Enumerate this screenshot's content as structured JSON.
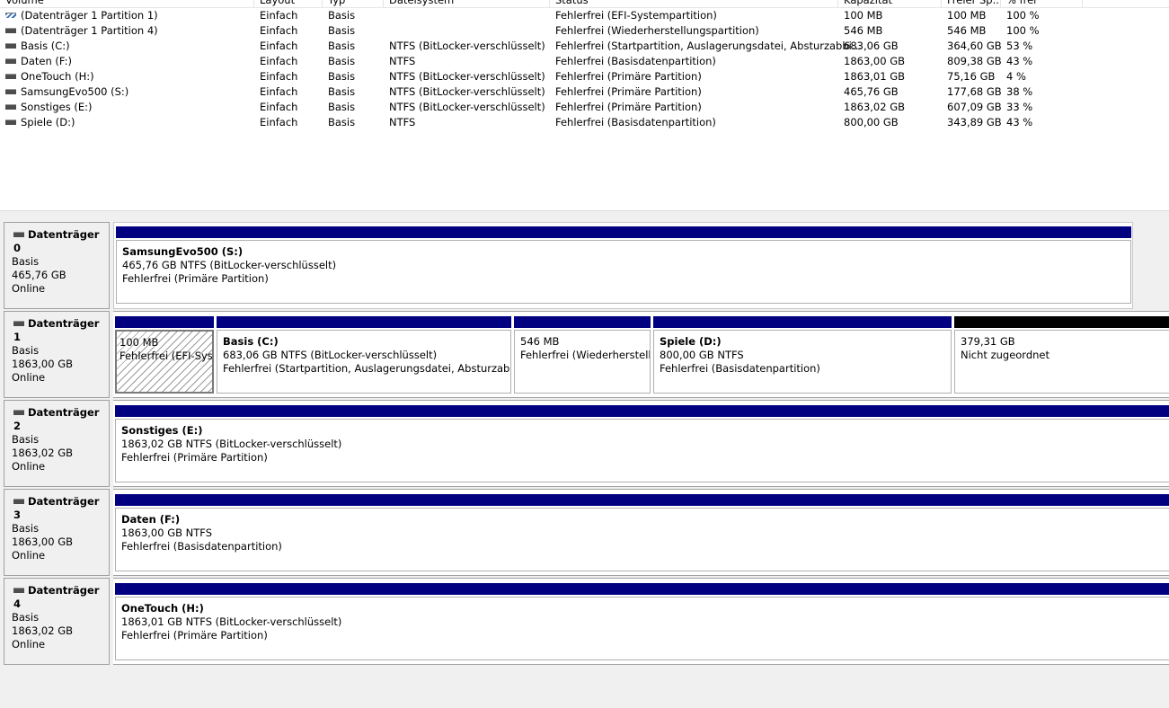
{
  "volume_table": {
    "columns": [
      "Volume",
      "Layout",
      "Typ",
      "Dateisystem",
      "Status",
      "Kapazität",
      "Freier Sp...",
      "% frei"
    ],
    "rows": [
      {
        "icon": "striped-volume-icon",
        "volume": "(Datenträger 1 Partition 1)",
        "layout": "Einfach",
        "typ": "Basis",
        "fs": "",
        "status": "Fehlerfrei (EFI-Systempartition)",
        "cap": "100 MB",
        "free": "100 MB",
        "pct": "100 %"
      },
      {
        "icon": "volume-icon",
        "volume": "(Datenträger 1 Partition 4)",
        "layout": "Einfach",
        "typ": "Basis",
        "fs": "",
        "status": "Fehlerfrei (Wiederherstellungspartition)",
        "cap": "546 MB",
        "free": "546 MB",
        "pct": "100 %"
      },
      {
        "icon": "volume-icon",
        "volume": "Basis (C:)",
        "layout": "Einfach",
        "typ": "Basis",
        "fs": "NTFS (BitLocker-verschlüsselt)",
        "status": "Fehlerfrei (Startpartition, Auslagerungsdatei, Absturzabbi...",
        "cap": "683,06 GB",
        "free": "364,60 GB",
        "pct": "53 %"
      },
      {
        "icon": "volume-icon",
        "volume": "Daten (F:)",
        "layout": "Einfach",
        "typ": "Basis",
        "fs": "NTFS",
        "status": "Fehlerfrei (Basisdatenpartition)",
        "cap": "1863,00 GB",
        "free": "809,38 GB",
        "pct": "43 %"
      },
      {
        "icon": "volume-icon",
        "volume": "OneTouch (H:)",
        "layout": "Einfach",
        "typ": "Basis",
        "fs": "NTFS (BitLocker-verschlüsselt)",
        "status": "Fehlerfrei (Primäre Partition)",
        "cap": "1863,01 GB",
        "free": "75,16 GB",
        "pct": "4 %"
      },
      {
        "icon": "volume-icon",
        "volume": "SamsungEvo500 (S:)",
        "layout": "Einfach",
        "typ": "Basis",
        "fs": "NTFS (BitLocker-verschlüsselt)",
        "status": "Fehlerfrei (Primäre Partition)",
        "cap": "465,76 GB",
        "free": "177,68 GB",
        "pct": "38 %"
      },
      {
        "icon": "volume-icon",
        "volume": "Sonstiges (E:)",
        "layout": "Einfach",
        "typ": "Basis",
        "fs": "NTFS (BitLocker-verschlüsselt)",
        "status": "Fehlerfrei (Primäre Partition)",
        "cap": "1863,02 GB",
        "free": "607,09 GB",
        "pct": "33 %"
      },
      {
        "icon": "volume-icon",
        "volume": "Spiele (D:)",
        "layout": "Einfach",
        "typ": "Basis",
        "fs": "NTFS",
        "status": "Fehlerfrei (Basisdatenpartition)",
        "cap": "800,00 GB",
        "free": "343,89 GB",
        "pct": "43 %"
      }
    ]
  },
  "disks": [
    {
      "title": "Datenträger 0",
      "type": "Basis",
      "size": "465,76 GB",
      "state": "Online",
      "partitions": [
        {
          "name": "SamsungEvo500  (S:)",
          "line1": "465,76 GB NTFS (BitLocker-verschlüsselt)",
          "line2": "Fehlerfrei (Primäre Partition)",
          "style": "normal"
        }
      ]
    },
    {
      "title": "Datenträger 1",
      "type": "Basis",
      "size": "1863,00 GB",
      "state": "Online",
      "partitions": [
        {
          "name": "",
          "line1": "100 MB",
          "line2": "Fehlerfrei (EFI-Syst",
          "style": "hatched"
        },
        {
          "name": "Basis  (C:)",
          "line1": "683,06 GB NTFS (BitLocker-verschlüsselt)",
          "line2": "Fehlerfrei (Startpartition, Auslagerungsdatei, Absturzabbild,",
          "style": "normal"
        },
        {
          "name": "",
          "line1": "546 MB",
          "line2": "Fehlerfrei (Wiederherstellu",
          "style": "normal"
        },
        {
          "name": "Spiele  (D:)",
          "line1": "800,00 GB NTFS",
          "line2": "Fehlerfrei (Basisdatenpartition)",
          "style": "normal"
        },
        {
          "name": "",
          "line1": "379,31 GB",
          "line2": "Nicht zugeordnet",
          "style": "unallocated"
        }
      ]
    },
    {
      "title": "Datenträger 2",
      "type": "Basis",
      "size": "1863,02 GB",
      "state": "Online",
      "partitions": [
        {
          "name": "Sonstiges  (E:)",
          "line1": "1863,02 GB NTFS (BitLocker-verschlüsselt)",
          "line2": "Fehlerfrei (Primäre Partition)",
          "style": "normal"
        }
      ]
    },
    {
      "title": "Datenträger 3",
      "type": "Basis",
      "size": "1863,00 GB",
      "state": "Online",
      "partitions": [
        {
          "name": "Daten  (F:)",
          "line1": "1863,00 GB NTFS",
          "line2": "Fehlerfrei (Basisdatenpartition)",
          "style": "normal"
        }
      ]
    },
    {
      "title": "Datenträger 4",
      "type": "Basis",
      "size": "1863,02 GB",
      "state": "Online",
      "partitions": [
        {
          "name": "OneTouch  (H:)",
          "line1": "1863,01 GB NTFS (BitLocker-verschlüsselt)",
          "line2": "Fehlerfrei (Primäre Partition)",
          "style": "normal"
        }
      ]
    }
  ],
  "colors": {
    "partition_bar": "#000080",
    "unallocated_bar": "#000000"
  }
}
